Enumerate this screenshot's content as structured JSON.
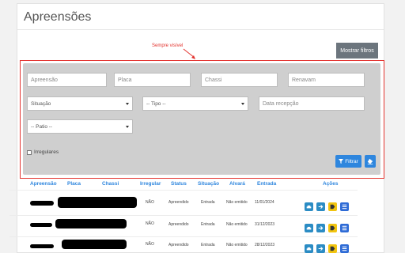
{
  "header": {
    "title": "Apreensões"
  },
  "annotation": {
    "text": "Sempre visível"
  },
  "buttons": {
    "toggle_filters": "Mostrar filtros",
    "filter": "Filtrar"
  },
  "filters": {
    "apreensao_placeholder": "Apreensão",
    "placa_placeholder": "Placa",
    "chassi_placeholder": "Chassi",
    "renavam_placeholder": "Renavam",
    "situacao_value": "Situação",
    "tipo_value": "-- Tipo --",
    "data_placeholder": "Data recepção",
    "patio_value": "-- Patio --",
    "irregulares_label": "Irregulares"
  },
  "table": {
    "columns": [
      "Apreensão",
      "Placa",
      "Chassi",
      "Irregular",
      "Status",
      "Situação",
      "Alvará",
      "Entrada",
      "Ações"
    ],
    "rows": [
      {
        "irregular": "NÃO",
        "status": "Apreendido",
        "situacao": "Entrada",
        "alvara": "Não emitido",
        "entrada": "11/01/2024"
      },
      {
        "irregular": "NÃO",
        "status": "Apreendido",
        "situacao": "Entrada",
        "alvara": "Não emitido",
        "entrada": "31/12/2023"
      },
      {
        "irregular": "NÃO",
        "status": "Apreendido",
        "situacao": "Entrada",
        "alvara": "Não emitido",
        "entrada": "28/12/2023"
      }
    ]
  },
  "colors": {
    "accent": "#2e86de",
    "annotation": "#e3342f",
    "panel": "#cfcfcf"
  }
}
